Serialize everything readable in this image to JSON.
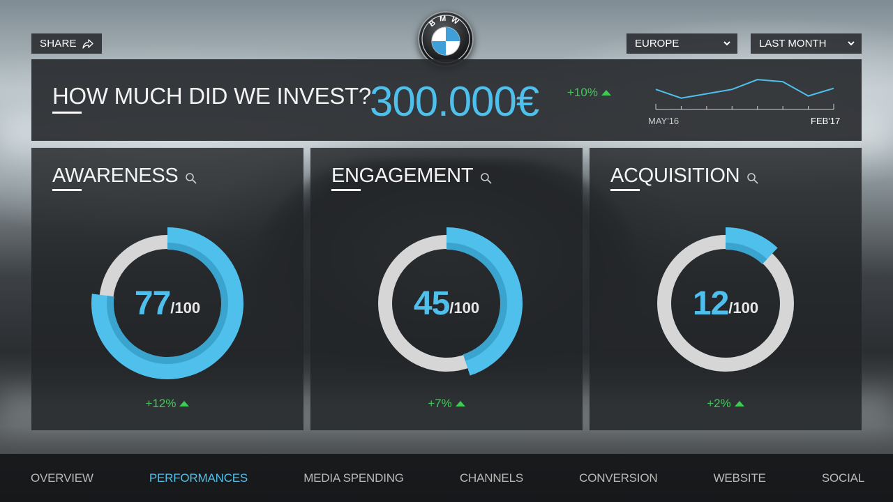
{
  "header": {
    "share_label": "SHARE",
    "logo_text": "BMW",
    "region_select": {
      "selected": "EUROPE"
    },
    "period_select": {
      "selected": "LAST MONTH"
    }
  },
  "invest": {
    "question": "HOW MUCH DID WE INVEST?",
    "amount": "300.000€",
    "delta": "+10%",
    "trend": {
      "start_label": "MAY'16",
      "end_label": "FEB'17",
      "values": [
        58,
        50,
        54,
        58,
        67,
        65,
        52,
        59
      ]
    }
  },
  "cards": [
    {
      "title": "AWARENESS",
      "score": 77,
      "score_text": "77",
      "max_text": "/100",
      "delta": "+12%"
    },
    {
      "title": "ENGAGEMENT",
      "score": 45,
      "score_text": "45",
      "max_text": "/100",
      "delta": "+7%"
    },
    {
      "title": "ACQUISITION",
      "score": 12,
      "score_text": "12",
      "max_text": "/100",
      "delta": "+2%"
    }
  ],
  "nav": {
    "items": [
      {
        "label": "OVERVIEW",
        "active": false
      },
      {
        "label": "PERFORMANCES",
        "active": true
      },
      {
        "label": "MEDIA SPENDING",
        "active": false
      },
      {
        "label": "CHANNELS",
        "active": false
      },
      {
        "label": "CONVERSION",
        "active": false
      },
      {
        "label": "WEBSITE",
        "active": false
      },
      {
        "label": "SOCIAL",
        "active": false
      }
    ]
  },
  "colors": {
    "accent": "#4fc0ec",
    "accent_dark": "#3aa4cf",
    "positive": "#3ecb55",
    "ring_track": "#d6d6d6"
  }
}
